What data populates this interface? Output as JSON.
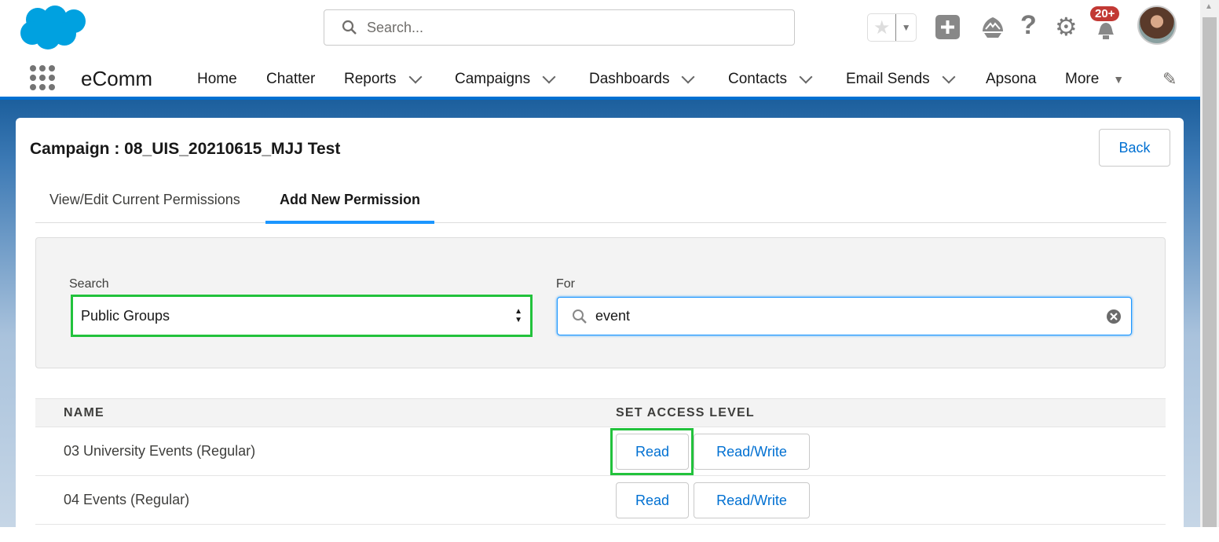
{
  "header": {
    "search_placeholder": "Search...",
    "notification_count": "20+"
  },
  "nav": {
    "app_name": "eComm",
    "items": [
      {
        "label": "Home"
      },
      {
        "label": "Chatter"
      },
      {
        "label": "Reports"
      },
      {
        "label": "Campaigns"
      },
      {
        "label": "Dashboards"
      },
      {
        "label": "Contacts"
      },
      {
        "label": "Email Sends"
      },
      {
        "label": "Apsona"
      },
      {
        "label": "More"
      }
    ]
  },
  "page": {
    "title": "Campaign : 08_UIS_20210615_MJJ Test",
    "back_label": "Back",
    "tabs": [
      {
        "label": "View/Edit Current Permissions"
      },
      {
        "label": "Add New Permission",
        "active": true
      }
    ],
    "filter": {
      "search_label": "Search",
      "search_value": "Public Groups",
      "for_label": "For",
      "for_value": "event"
    },
    "table": {
      "headers": [
        "NAME",
        "SET ACCESS LEVEL"
      ],
      "rows": [
        {
          "name": "03 University Events (Regular)",
          "read": "Read",
          "read_write": "Read/Write"
        },
        {
          "name": "04 Events (Regular)",
          "read": "Read",
          "read_write": "Read/Write"
        }
      ]
    }
  },
  "colors": {
    "brand": "#00a1e0",
    "accent": "#0070d2",
    "highlight": "#22c23c",
    "badge": "#c23934"
  }
}
